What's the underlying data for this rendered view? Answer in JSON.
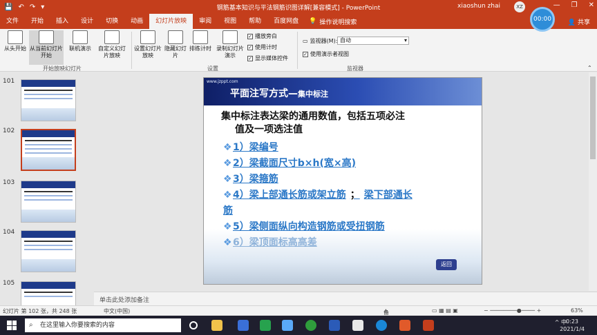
{
  "window": {
    "doc_title": "钢筋基本知识与平法钢筋识图详解[兼容模式] - PowerPoint",
    "user_name": "xiaoshun zhai",
    "avatar_initials": "XZ",
    "minimize": "—",
    "restore": "❐",
    "close": "✕"
  },
  "quick_access": {
    "save": "💾",
    "undo": "↶",
    "redo": "↷",
    "more": "▾"
  },
  "tabs": [
    "文件",
    "开始",
    "插入",
    "设计",
    "切换",
    "动画",
    "幻灯片放映",
    "审阅",
    "视图",
    "帮助",
    "百度网盘"
  ],
  "active_tab": "幻灯片放映",
  "search_label": "操作说明搜索",
  "share_label": "共享",
  "timer": "00:00",
  "ribbon": {
    "btn_from_start": "从头开始",
    "btn_from_current": "从当前幻灯片开始",
    "btn_online": "联机演示",
    "btn_custom": "自定义幻灯片放映",
    "group_start": "开始放映幻灯片",
    "btn_setup": "设置幻灯片放映",
    "btn_hide": "隐藏幻灯片",
    "btn_rehearse": "排练计时",
    "btn_record": "录制幻灯片演示",
    "chk_narration": "播放旁白",
    "chk_timings": "使用计时",
    "chk_media": "显示媒体控件",
    "group_setup": "设置",
    "monitor_label": "监视器(M):",
    "monitor_value": "自动",
    "chk_presenter": "使用演示者视图",
    "group_monitors": "监视器"
  },
  "slides": [
    {
      "num": "101"
    },
    {
      "num": "102",
      "selected": true
    },
    {
      "num": "103"
    },
    {
      "num": "104"
    },
    {
      "num": "105"
    }
  ],
  "slide": {
    "url": "www.jzppt.com",
    "title_main": "平面注写方式—",
    "title_sub": "集中标注",
    "headline_1": "集中标注表达梁的通用数值，包括五项必注",
    "headline_2": "值及一项选注值",
    "bullets": [
      "1）梁编号",
      "2）梁截面尺寸b×h(宽×高)",
      "3）梁箍筋",
      "4）梁上部通长筋或架立筋",
      "5）梁侧面纵向构造钢筋或受扭钢筋",
      "6）梁顶面标高高差"
    ],
    "bullet4_sep": "；",
    "bullet4_extra": "梁下部通长",
    "bullet4_wrap": "筋",
    "bullet_marker": "❖",
    "back_button": "返回"
  },
  "notes_placeholder": "单击此处添加备注",
  "status": {
    "slide_info": "幻灯片 第 102 张，共 248 张",
    "language": "中文(中国)",
    "notes_btn": "备注",
    "zoom": "63%"
  },
  "taskbar": {
    "search_placeholder": "在这里输入你要搜索的内容",
    "tray": "^ 中",
    "time": "0:23",
    "date": "2021/1/4"
  }
}
